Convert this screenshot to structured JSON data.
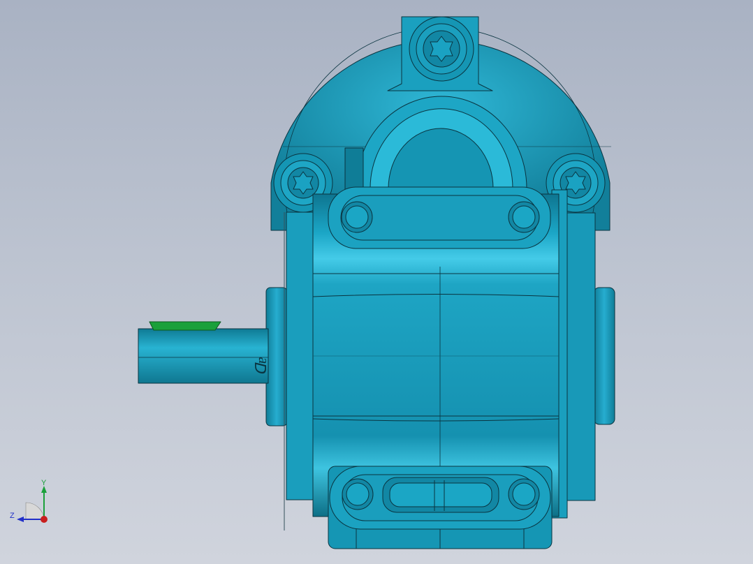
{
  "viewport": {
    "background_top": "#a9b2c3",
    "background_bottom": "#d0d4dd"
  },
  "model": {
    "body_color": "#1596b4",
    "body_highlight": "#3cc4e2",
    "body_shadow": "#0d6f86",
    "edge_color": "#0a3440",
    "key_color": "#1aa03a",
    "shaft_engraving": "ꓷɐ"
  },
  "triad": {
    "y_label": "Y",
    "z_label": "Z",
    "y_color": "#1aa03a",
    "z_color": "#2230c8",
    "x_color": "#c81e1e"
  }
}
